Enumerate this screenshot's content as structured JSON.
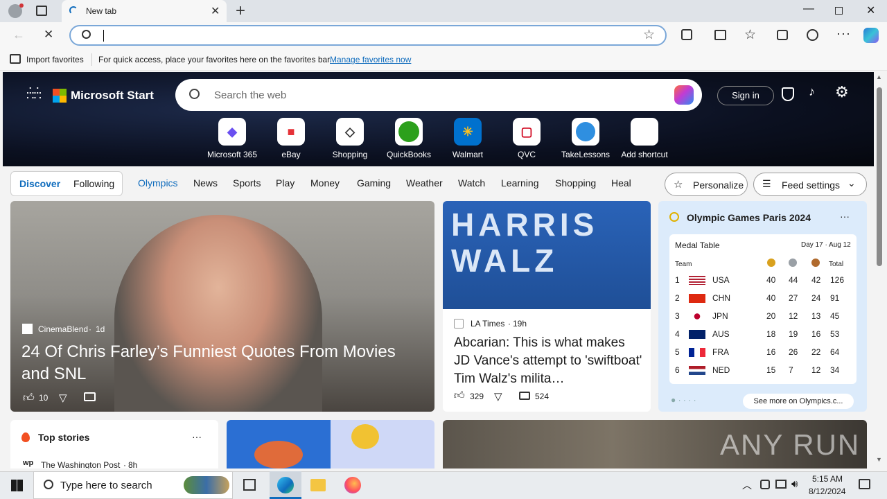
{
  "browser": {
    "tab_title": "New tab",
    "favbar_import": "Import favorites",
    "favbar_hint": "For quick access, place your favorites here on the favorites bar.",
    "favbar_link": "Manage favorites now"
  },
  "msstart": {
    "brand": "Microsoft Start",
    "search_placeholder": "Search the web",
    "signin": "Sign in"
  },
  "shortcuts": [
    {
      "label": "Microsoft 365"
    },
    {
      "label": "eBay"
    },
    {
      "label": "Shopping"
    },
    {
      "label": "QuickBooks"
    },
    {
      "label": "Walmart"
    },
    {
      "label": "QVC"
    },
    {
      "label": "TakeLessons"
    },
    {
      "label": "Add shortcut"
    }
  ],
  "feed_tabs": {
    "discover": "Discover",
    "following": "Following"
  },
  "nav": [
    "Olympics",
    "News",
    "Sports",
    "Play",
    "Money",
    "Gaming",
    "Weather",
    "Watch",
    "Learning",
    "Shopping",
    "Heal"
  ],
  "personalize": "Personalize",
  "feed_settings": "Feed settings",
  "article_main": {
    "source": "CinemaBlend",
    "age": "1d",
    "title": "24 Of Chris Farley’s Funniest Quotes From Movies and SNL",
    "likes": "10"
  },
  "article_side": {
    "banner_text": "HARRIS WALZ",
    "source": "LA Times",
    "age": "19h",
    "title": "Abcarian: This is what makes JD Vance's attempt to 'swiftboat' Tim Walz's milita…",
    "likes": "329",
    "comments": "524"
  },
  "olympics": {
    "title": "Olympic Games Paris 2024",
    "table_title": "Medal Table",
    "dates": "Day 17 · Aug 12",
    "col_team": "Team",
    "col_total": "Total",
    "rows": [
      {
        "rank": "1",
        "team": "USA",
        "g": "40",
        "s": "44",
        "b": "42",
        "t": "126"
      },
      {
        "rank": "2",
        "team": "CHN",
        "g": "40",
        "s": "27",
        "b": "24",
        "t": "91"
      },
      {
        "rank": "3",
        "team": "JPN",
        "g": "20",
        "s": "12",
        "b": "13",
        "t": "45"
      },
      {
        "rank": "4",
        "team": "AUS",
        "g": "18",
        "s": "19",
        "b": "16",
        "t": "53"
      },
      {
        "rank": "5",
        "team": "FRA",
        "g": "16",
        "s": "26",
        "b": "22",
        "t": "64"
      },
      {
        "rank": "6",
        "team": "NED",
        "g": "15",
        "s": "7",
        "b": "12",
        "t": "34"
      }
    ],
    "see_more": "See more on Olympics.c..."
  },
  "top_stories": {
    "title": "Top stories",
    "source": "The Washington Post",
    "age": "8h"
  },
  "watermark": "ANY RUN",
  "taskbar": {
    "search_placeholder": "Type here to search",
    "time": "5:15 AM",
    "date": "8/12/2024"
  }
}
